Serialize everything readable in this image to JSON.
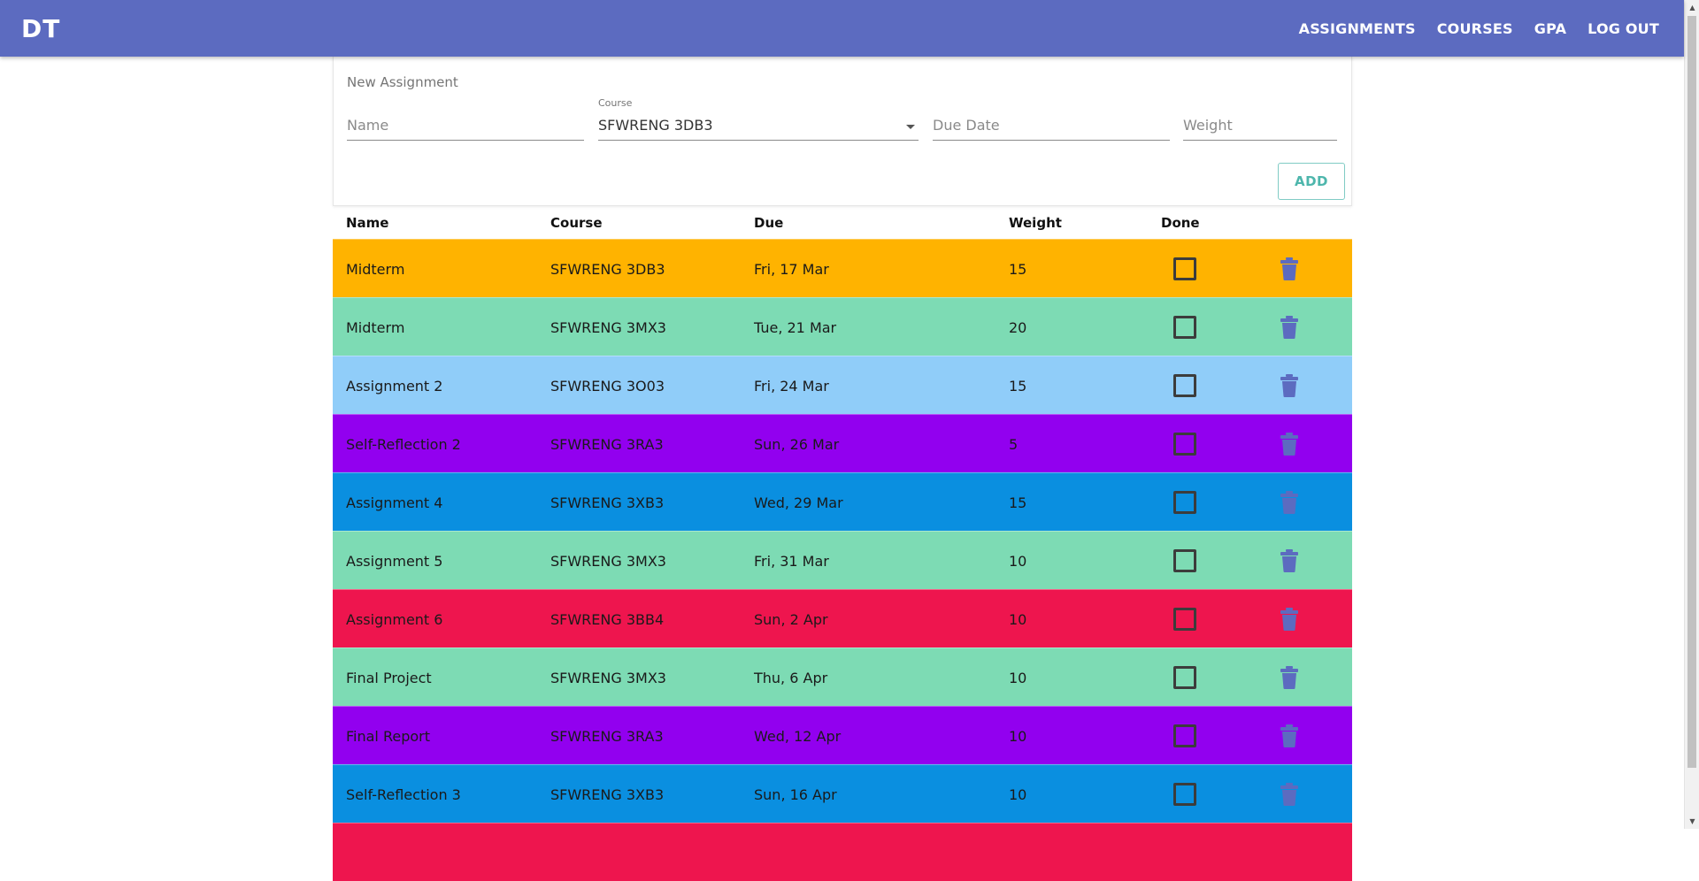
{
  "app": {
    "logo": "DT",
    "nav": [
      "ASSIGNMENTS",
      "COURSES",
      "GPA",
      "LOG OUT"
    ]
  },
  "form": {
    "title": "New Assignment",
    "name_placeholder": "Name",
    "course_label": "Course",
    "course_value": "SFWRENG 3DB3",
    "due_placeholder": "Due Date",
    "weight_placeholder": "Weight",
    "add_label": "ADD"
  },
  "table": {
    "headers": {
      "name": "Name",
      "course": "Course",
      "due": "Due",
      "weight": "Weight",
      "done": "Done"
    },
    "rows": [
      {
        "name": "Midterm",
        "course": "SFWRENG 3DB3",
        "due": "Fri, 17 Mar",
        "weight": "15",
        "color": "#ffb300"
      },
      {
        "name": "Midterm",
        "course": "SFWRENG 3MX3",
        "due": "Tue, 21 Mar",
        "weight": "20",
        "color": "#7ddbb4"
      },
      {
        "name": "Assignment 2",
        "course": "SFWRENG 3O03",
        "due": "Fri, 24 Mar",
        "weight": "15",
        "color": "#90cdf9"
      },
      {
        "name": "Self-Reflection 2",
        "course": "SFWRENG 3RA3",
        "due": "Sun, 26 Mar",
        "weight": "5",
        "color": "#9200ef"
      },
      {
        "name": "Assignment 4",
        "course": "SFWRENG 3XB3",
        "due": "Wed, 29 Mar",
        "weight": "15",
        "color": "#0a8fe0"
      },
      {
        "name": "Assignment 5",
        "course": "SFWRENG 3MX3",
        "due": "Fri, 31 Mar",
        "weight": "10",
        "color": "#7ddbb4"
      },
      {
        "name": "Assignment 6",
        "course": "SFWRENG 3BB4",
        "due": "Sun, 2 Apr",
        "weight": "10",
        "color": "#ee154e"
      },
      {
        "name": "Final Project",
        "course": "SFWRENG 3MX3",
        "due": "Thu, 6 Apr",
        "weight": "10",
        "color": "#7ddbb4"
      },
      {
        "name": "Final Report",
        "course": "SFWRENG 3RA3",
        "due": "Wed, 12 Apr",
        "weight": "10",
        "color": "#9200ef"
      },
      {
        "name": "Self-Reflection 3",
        "course": "SFWRENG 3XB3",
        "due": "Sun, 16 Apr",
        "weight": "10",
        "color": "#0a8fe0"
      },
      {
        "name": "",
        "course": "",
        "due": "",
        "weight": "",
        "color": "#ee154e"
      }
    ]
  },
  "colors": {
    "primary": "#5c6bc0",
    "accent": "#4db6ac"
  }
}
